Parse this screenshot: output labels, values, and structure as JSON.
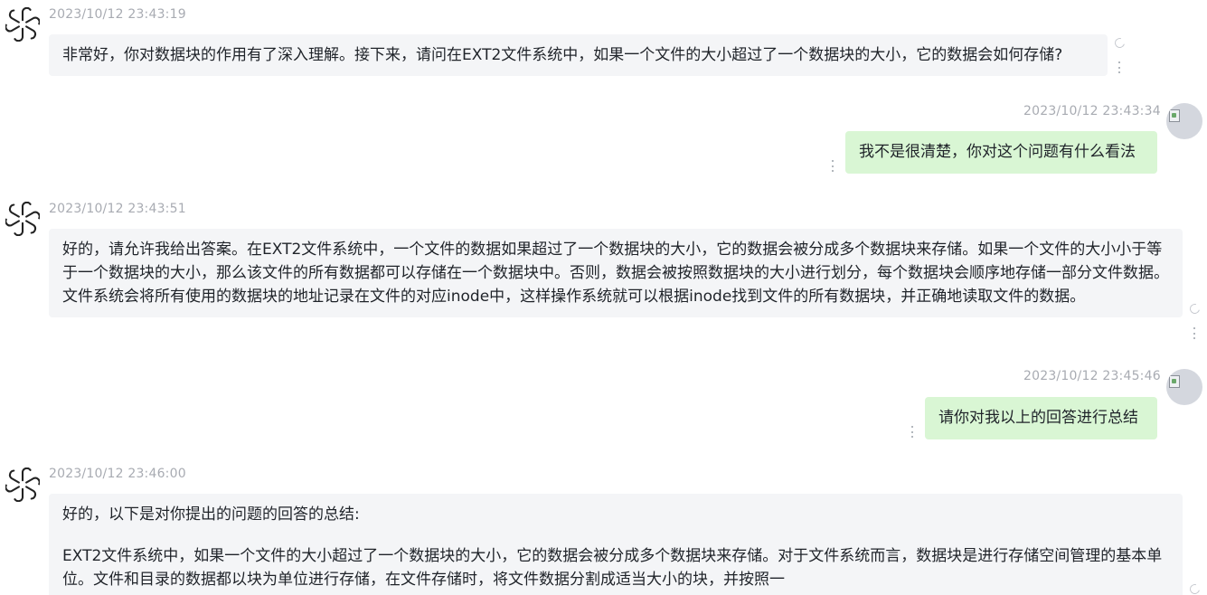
{
  "messages": [
    {
      "role": "assistant",
      "timestamp": "2023/10/12 23:43:19",
      "paragraphs": [
        "非常好，你对数据块的作用有了深入理解。接下来，请问在EXT2文件系统中，如果一个文件的大小超过了一个数据块的大小，它的数据会如何存储?"
      ]
    },
    {
      "role": "user",
      "timestamp": "2023/10/12 23:43:34",
      "text": "我不是很清楚，你对这个问题有什么看法"
    },
    {
      "role": "assistant",
      "timestamp": "2023/10/12 23:43:51",
      "paragraphs": [
        "好的，请允许我给出答案。在EXT2文件系统中，一个文件的数据如果超过了一个数据块的大小，它的数据会被分成多个数据块来存储。如果一个文件的大小小于等于一个数据块的大小，那么该文件的所有数据都可以存储在一个数据块中。否则，数据会被按照数据块的大小进行划分，每个数据块会顺序地存储一部分文件数据。文件系统会将所有使用的数据块的地址记录在文件的对应inode中，这样操作系统就可以根据inode找到文件的所有数据块，并正确地读取文件的数据。"
      ]
    },
    {
      "role": "user",
      "timestamp": "2023/10/12 23:45:46",
      "text": "请你对我以上的回答进行总结"
    },
    {
      "role": "assistant",
      "timestamp": "2023/10/12 23:46:00",
      "paragraphs": [
        "好的，以下是对你提出的问题的回答的总结:",
        "EXT2文件系统中，如果一个文件的大小超过了一个数据块的大小，它的数据会被分成多个数据块来存储。对于文件系统而言，数据块是进行存储空间管理的基本单位。文件和目录的数据都以块为单位进行存储，在文件存储时，将文件数据分割成适当大小的块，并按照一"
      ]
    }
  ],
  "icons": {
    "assistant_avatar": "openai-logo-icon",
    "user_avatar": "broken-image-avatar-icon",
    "status": "loading-ring-icon",
    "menu": "more-vertical-icon"
  },
  "colors": {
    "assistant_bubble": "#f4f5f7",
    "user_bubble": "#d9f6d4",
    "timestamp": "#a8abb2"
  }
}
